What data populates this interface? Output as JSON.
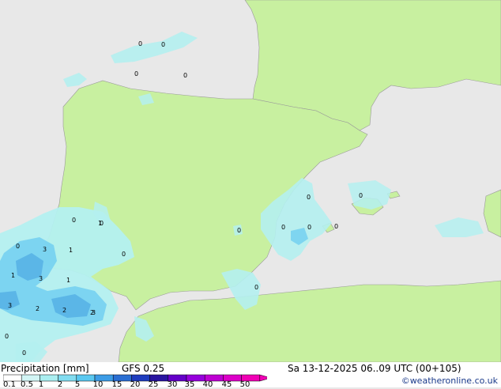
{
  "map": {
    "colors": {
      "sea": "#e8e8e8",
      "land": "#c8f0a0",
      "light_precip": "#b4f0f0",
      "med_precip": "#78d2f0",
      "heavy_precip": "#5ab4e6"
    },
    "point_labels": [
      "0",
      "0",
      "0",
      "0",
      "0",
      "0",
      "0",
      "0",
      "0",
      "0",
      "0",
      "0",
      "0",
      "0",
      "0",
      "1",
      "1",
      "1",
      "1",
      "3",
      "3",
      "3",
      "2",
      "2",
      "2",
      "3",
      "0",
      "0"
    ]
  },
  "footer": {
    "title": "Precipitation [mm]",
    "model": "GFS 0.25",
    "datetime": "Sa 13-12-2025 06..09 UTC (00+105)",
    "credit": "©weatheronline.co.uk",
    "scale_values": [
      "0.1",
      "0.5",
      "1",
      "2",
      "5",
      "10",
      "15",
      "20",
      "25",
      "30",
      "35",
      "40",
      "45",
      "50"
    ],
    "scale_colors": [
      "#ffffff",
      "#d2f5f5",
      "#aaeef0",
      "#82dcf0",
      "#5ac8f0",
      "#3c9ce6",
      "#2a6ed2",
      "#1e3cbe",
      "#2814a0",
      "#6400c8",
      "#9600dc",
      "#be00d2",
      "#dc00c8",
      "#f000b4"
    ]
  }
}
